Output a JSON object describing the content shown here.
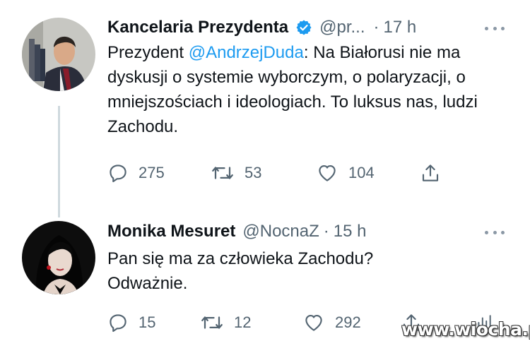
{
  "tweets": [
    {
      "author_name": "Kancelaria Prezydenta",
      "verified": true,
      "handle": "@pr...",
      "separator": "·",
      "time": "17 h",
      "text_before": "Prezydent ",
      "mention": "@AndrzejDuda",
      "text_after": ": Na Białorusi nie ma dyskusji o systemie wyborczym, o polaryzacji, o mniejszościach i ideologiach. To luksus nas, ludzi Zachodu.",
      "replies": "275",
      "retweets": "53",
      "likes": "104"
    },
    {
      "author_name": "Monika Mesuret",
      "verified": false,
      "handle": "@NocnaZ",
      "separator": "·",
      "time": "15 h",
      "text": "Pan się ma za człowieka Zachodu? Odważnie.",
      "replies": "15",
      "retweets": "12",
      "likes": "292"
    }
  ],
  "watermark": "www.wiocha.pl",
  "icons": {
    "verified": "verified-badge-icon",
    "reply": "reply-icon",
    "retweet": "retweet-icon",
    "like": "like-icon",
    "share": "share-icon",
    "more": "more-icon"
  },
  "colors": {
    "text": "#0f1419",
    "secondary": "#536471",
    "link": "#1d9bf0",
    "thread_line": "#cfd9de"
  }
}
